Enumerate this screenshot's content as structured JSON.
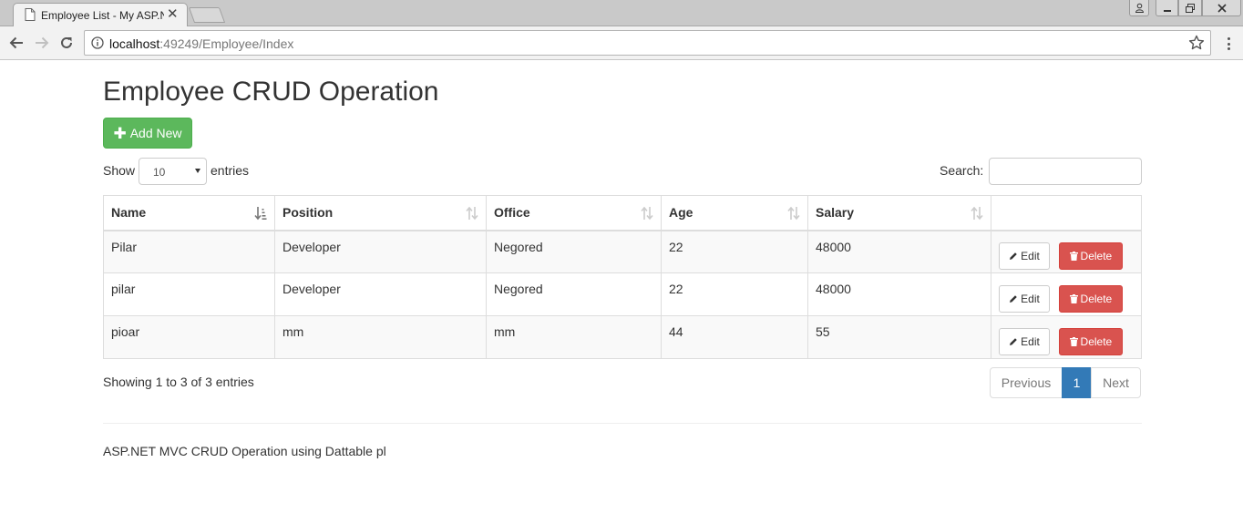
{
  "browser": {
    "tab_title": "Employee List - My ASP.NET",
    "url_host": "localhost",
    "url_rest": ":49249/Employee/Index"
  },
  "page": {
    "title": "Employee CRUD Operation",
    "add_button": "Add New",
    "show_label": "Show",
    "entries_label": "entries",
    "page_length": "10",
    "search_label": "Search:",
    "search_value": ""
  },
  "table": {
    "columns": [
      "Name",
      "Position",
      "Office",
      "Age",
      "Salary",
      ""
    ],
    "rows": [
      {
        "name": "Pilar",
        "position": "Developer",
        "office": "Negored",
        "age": "22",
        "salary": "48000"
      },
      {
        "name": "pilar",
        "position": "Developer",
        "office": "Negored",
        "age": "22",
        "salary": "48000"
      },
      {
        "name": "pioar",
        "position": "mm",
        "office": "mm",
        "age": "44",
        "salary": "55"
      }
    ],
    "edit_label": "Edit",
    "delete_label": "Delete"
  },
  "footer_info": "Showing 1 to 3 of 3 entries",
  "pagination": {
    "previous": "Previous",
    "current": "1",
    "next": "Next"
  },
  "footer_text": "ASP.NET MVC CRUD Operation using Dattable pl",
  "colors": {
    "success": "#5cb85c",
    "danger": "#d9534f",
    "primary": "#337ab7"
  }
}
